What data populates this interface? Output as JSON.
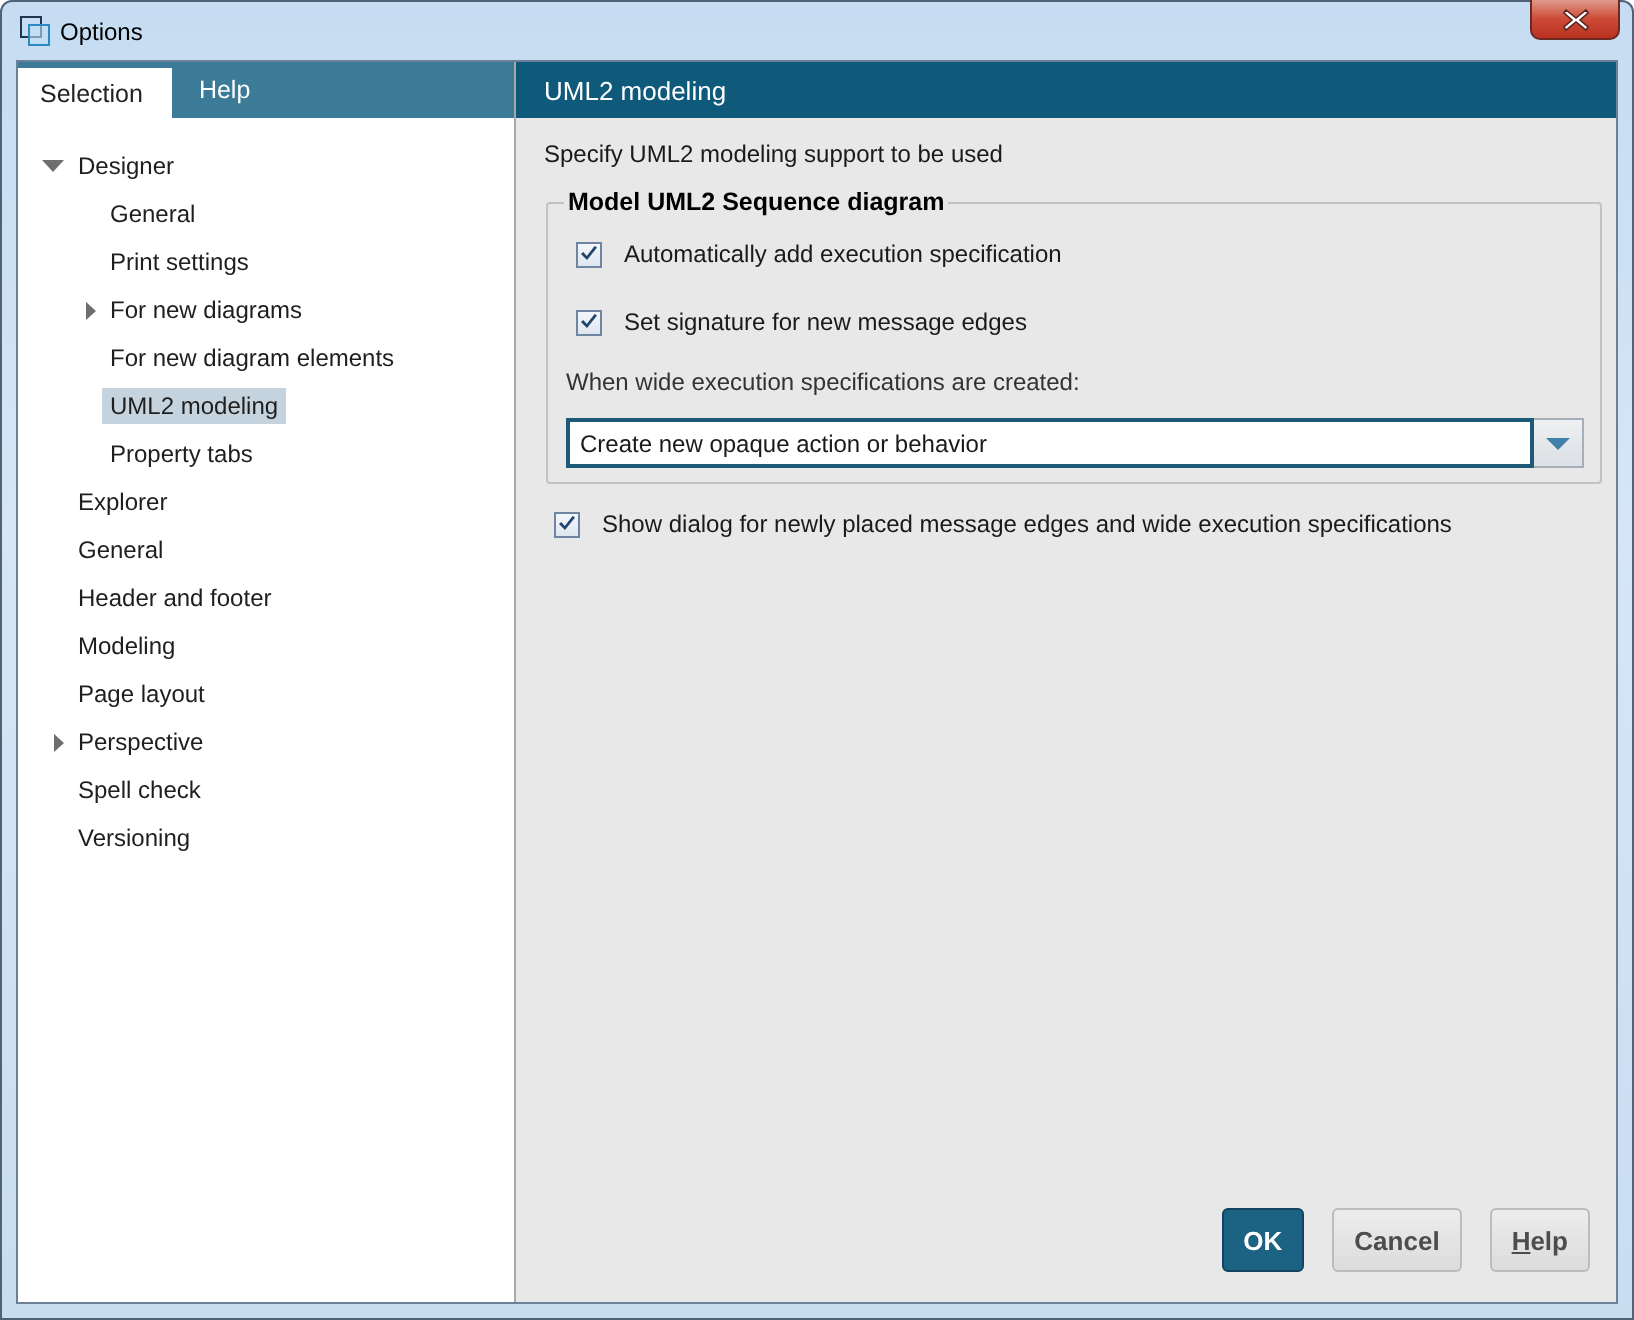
{
  "window": {
    "title": "Options"
  },
  "left_tabs": [
    {
      "label": "Selection",
      "selected": true
    },
    {
      "label": "Help",
      "selected": false
    }
  ],
  "tree": [
    {
      "label": "Designer",
      "selected": false,
      "expanded": true,
      "children": [
        {
          "label": "General",
          "selected": false
        },
        {
          "label": "Print settings",
          "selected": false
        },
        {
          "label": "For new diagrams",
          "selected": false,
          "expanded": false
        },
        {
          "label": "For new diagram elements",
          "selected": false
        },
        {
          "label": "UML2 modeling",
          "selected": true
        },
        {
          "label": "Property tabs",
          "selected": false
        }
      ]
    },
    {
      "label": "Explorer",
      "selected": false
    },
    {
      "label": "General",
      "selected": false
    },
    {
      "label": "Header and footer",
      "selected": false
    },
    {
      "label": "Modeling",
      "selected": false
    },
    {
      "label": "Page layout",
      "selected": false
    },
    {
      "label": "Perspective",
      "selected": false,
      "expanded": false
    },
    {
      "label": "Spell check",
      "selected": false
    },
    {
      "label": "Versioning",
      "selected": false
    }
  ],
  "panel": {
    "title": "UML2 modeling",
    "description": "Specify UML2 modeling support to be used",
    "group": {
      "legend": "Model UML2 Sequence diagram",
      "checkboxes": [
        {
          "label": "Automatically add execution specification",
          "checked": true
        },
        {
          "label": "Set signature for new message edges",
          "checked": true
        }
      ],
      "combo_label": "When wide execution specifications are created:",
      "combo": {
        "value": "Create new opaque action or behavior"
      }
    },
    "checkboxes": [
      {
        "label": "Show dialog for newly placed message edges and wide execution specifications",
        "checked": true
      }
    ]
  },
  "buttons": [
    {
      "label": "OK",
      "kind": "primary",
      "underline_first": false
    },
    {
      "label": "Cancel",
      "kind": "secondary",
      "underline_first": false
    },
    {
      "label": "Help",
      "kind": "secondary",
      "underline_first": true
    }
  ]
}
